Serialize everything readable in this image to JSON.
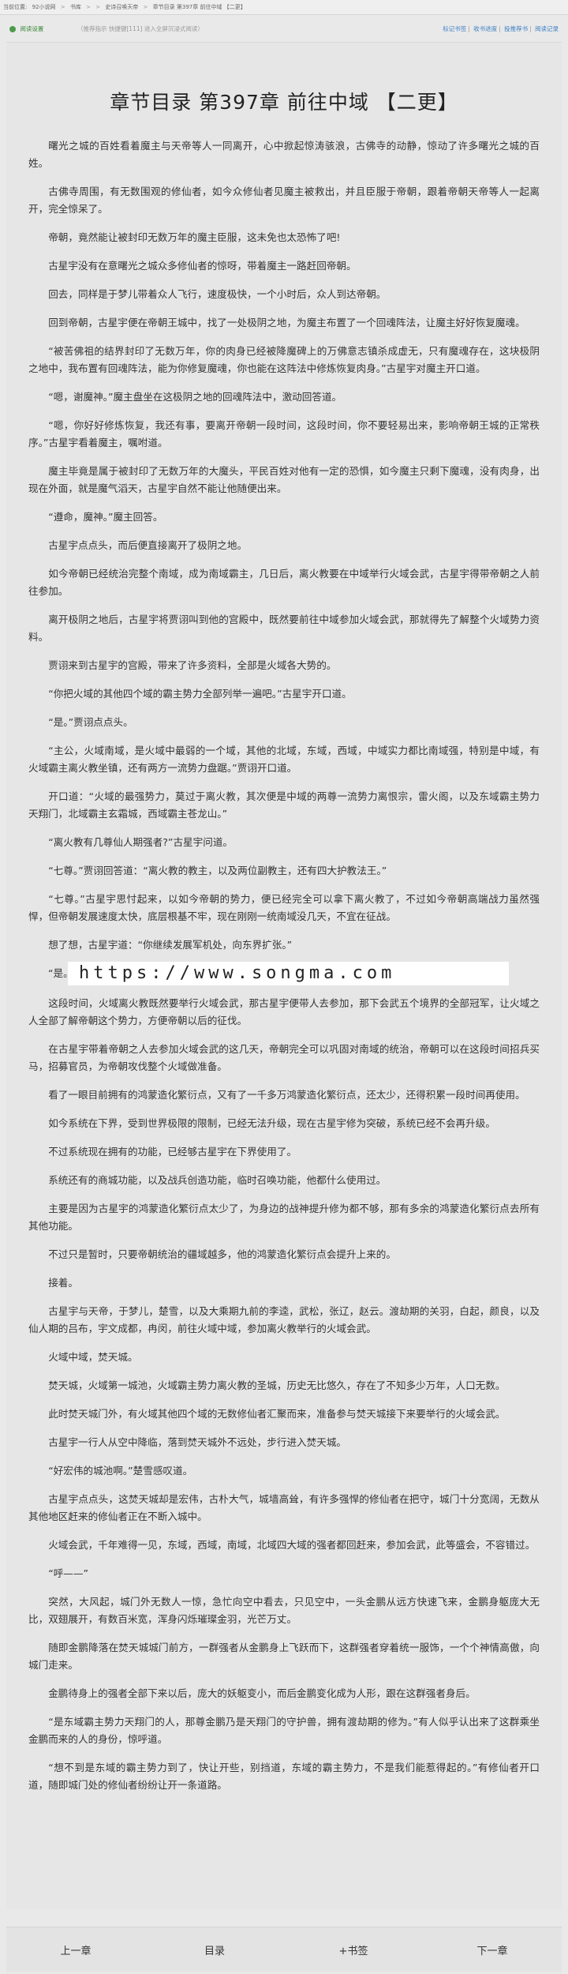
{
  "topbar": {
    "prefix": "当前位置:",
    "site": "92小说网",
    "sep1": ">",
    "lib": "书库",
    "sep2": ">",
    "sep3": ">",
    "book": "史诗召唤天帝",
    "sep4": ">",
    "chapter": "章节目录 第397章 前往中域 【二更】"
  },
  "toolbar": {
    "settings_label": "阅读设置",
    "notice": "（推荐指示 快捷键[111] 进入全屏沉浸式阅读）",
    "links": [
      "标记书签",
      "收书进度",
      "投推荐书",
      "阅读记录"
    ]
  },
  "chapter": {
    "title": "章节目录 第397章 前往中域 【二更】"
  },
  "paragraphs": [
    "曙光之城的百姓看着魔主与天帝等人一同离开，心中掀起惊涛骇浪，古佛寺的动静，惊动了许多曙光之城的百姓。",
    "古佛寺周围，有无数围观的修仙者，如今众修仙者见魔主被救出，并且臣服于帝朝，跟着帝朝天帝等人一起离开，完全惊呆了。",
    "帝朝，竟然能让被封印无数万年的魔主臣服，这未免也太恐怖了吧!",
    "古星宇没有在意曙光之城众多修仙者的惊呀，带着魔主一路赶回帝朝。",
    "回去，同样是于梦儿带着众人飞行，速度极快，一个小时后，众人到达帝朝。",
    "回到帝朝，古星宇便在帝朝王城中，找了一处极阴之地，为魔主布置了一个回魂阵法，让魔主好好恢复魔魂。",
    "“被苦佛祖的结界封印了无数万年，你的肉身已经被降魔碑上的万佛意志镇杀成虚无，只有魔魂存在，这块极阴之地中，我布置有回魂阵法，能为你修复魔魂，你也能在这阵法中修炼恢复肉身。”古星宇对魔主开口道。",
    "“嗯，谢魔神。”魔主盘坐在这极阴之地的回魂阵法中，激动回答道。",
    "“嗯，你好好修炼恢复，我还有事，要离开帝朝一段时间，这段时间，你不要轻易出来，影响帝朝王城的正常秩序。”古星宇看着魔主，嘱咐道。",
    "魔主毕竟是属于被封印了无数万年的大魔头，平民百姓对他有一定的恐惧，如今魔主只剩下魔魂，没有肉身，出现在外面，就是魔气滔天，古星宇自然不能让他随便出来。",
    "“遵命，魔神。”魔主回答。",
    "古星宇点点头，而后便直接离开了极阴之地。",
    "如今帝朝已经统治完整个南域，成为南域霸主，几日后，离火教要在中域举行火域会武，古星宇得带帝朝之人前往参加。",
    "离开极阴之地后，古星宇将贾诩叫到他的宫殿中，既然要前往中域参加火域会武，那就得先了解整个火域势力资料。",
    "贾诩来到古星宇的宫殿，带来了许多资料，全部是火域各大势的。",
    "“你把火域的其他四个域的霸主势力全部列举一遍吧。”古星宇开口道。",
    "“是。”贾诩点点头。",
    "“主公，火域南域，是火域中最弱的一个域，其他的北域，东域，西域，中域实力都比南域强，特别是中域，有火域霸主离火教坐镇，还有两方一流势力盘踞。”贾诩开口道。",
    "开口道：“火域的最强势力，莫过于离火教，其次便是中域的两尊一流势力离恨宗，雷火阁，以及东域霸主势力天翔门，北域霸主玄霜城，西域霸主苍龙山。”",
    "“离火教有几尊仙人期强者?”古星宇问道。",
    "“七尊。”贾诩回答道：“离火教的教主，以及两位副教主，还有四大护教法王。”",
    "“七尊。”古星宇思忖起来，以如今帝朝的势力，便已经完全可以拿下离火教了，不过如今帝朝高端战力虽然强悍，但帝朝发展速度太快，底层根基不牢，现在刚刚一统南域没几天，不宜在征战。",
    "想了想，古星宇道：“你继续发展军机处，向东界扩张。”"
  ],
  "watermark_row": {
    "lead": "“是。”",
    "text": "https://www.songma.com"
  },
  "paragraphs2": [
    "这段时间，火域离火教既然要举行火域会武，那古星宇便带人去参加，那下会武五个境界的全部冠军，让火域之人全部了解帝朝这个势力，方便帝朝以后的征伐。",
    "在古星宇带着帝朝之人去参加火域会武的这几天，帝朝完全可以巩固对南域的统治，帝朝可以在这段时间招兵买马，招募官员，为帝朝攻伐整个火域做准备。",
    "看了一眼目前拥有的鸿蒙造化繁衍点，又有了一千多万鸿蒙造化繁衍点，还太少，还得积累一段时间再使用。",
    "如今系统在下界，受到世界极限的限制，已经无法升级，现在古星宇修为突破，系统已经不会再升级。",
    "不过系统现在拥有的功能，已经够古星宇在下界使用了。",
    "系统还有的商城功能，以及战兵创造功能，临时召唤功能，他都什么使用过。",
    "主要是因为古星宇的鸿蒙造化繁衍点太少了，为身边的战神提升修为都不够，那有多余的鸿蒙造化繁衍点去所有其他功能。",
    "不过只是暂时，只要帝朝统治的疆域越多，他的鸿蒙造化繁衍点会提升上来的。",
    "接着。",
    "古星宇与天帝，于梦儿，楚雪，以及大乘期九前的李逵，武松，张辽，赵云。渡劫期的关羽，白起，颜良，以及仙人期的吕布，宇文成都，冉闵，前往火域中域，参加离火教举行的火域会武。",
    "火域中域，焚天城。",
    "焚天城，火域第一城池，火域霸主势力离火教的圣城，历史无比悠久，存在了不知多少万年，人口无数。",
    "此时焚天城门外，有火域其他四个域的无数修仙者汇聚而来，准备参与焚天城接下来要举行的火域会武。",
    "古星宇一行人从空中降临，落到焚天城外不远处，步行进入焚天城。",
    "“好宏伟的城池啊。”楚雪感叹道。",
    "古星宇点点头，这焚天城却是宏伟，古朴大气，城墙高耸，有许多强悍的修仙者在把守，城门十分宽阔，无数从其他地区赶来的修仙者正在不断入城中。",
    "火域会武，千年难得一见，东域，西域，南域，北域四大域的强者都回赶来，参加会武，此等盛会，不容错过。",
    "“呼——”",
    "突然，大风起，城门外无数人一惊，急忙向空中看去，只见空中，一头金鹏从远方快速飞来，金鹏身躯庞大无比，双翅展开，有数百米宽，浑身闪烁璀璨金羽，光芒万丈。",
    "随即金鹏降落在焚天城城门前方，一群强者从金鹏身上飞跃而下，这群强者穿着统一服饰，一个个神情高傲，向城门走来。",
    "金鹏待身上的强者全部下来以后，庞大的妖躯变小，而后金鹏变化成为人形，跟在这群强者身后。",
    "“是东域霸主势力天翔门的人，那尊金鹏乃是天翔门的守护兽，拥有渡劫期的修为。”有人似乎认出来了这群乘坐金鹏而来的人的身份，惊呼道。",
    "“想不到是东域的霸主势力到了，快让开些，别挡道，东域的霸主势力，不是我们能惹得起的。”有修仙者开口道，随即城门处的修仙者纷纷让开一条道路。"
  ],
  "bottom_nav": {
    "prev": "上一章",
    "toc": "目录",
    "bookmark": "+书签",
    "next": "下一章"
  }
}
